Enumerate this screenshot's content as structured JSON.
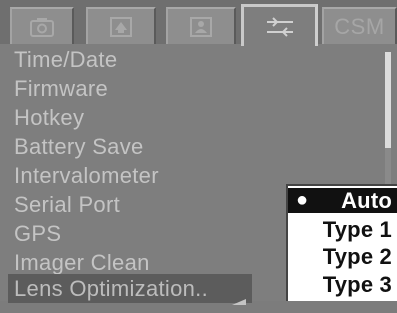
{
  "tabs": [
    {
      "name": "camera",
      "icon": "camera-icon"
    },
    {
      "name": "playback",
      "icon": "playback-icon"
    },
    {
      "name": "custom",
      "icon": "custom-settings-icon"
    },
    {
      "name": "setup",
      "icon": "wrench-icon"
    },
    {
      "name": "csm",
      "label": "CSM"
    }
  ],
  "active_tab": "setup",
  "menu": {
    "items": [
      "Time/Date",
      "Firmware",
      "Hotkey",
      "Battery Save",
      "Intervalometer",
      "Serial Port",
      "GPS",
      "Imager Clean",
      "Lens Optimization.."
    ],
    "selected_index": 8
  },
  "submenu": {
    "options": [
      "Auto",
      "Type 1",
      "Type 2",
      "Type 3"
    ],
    "selected": "Auto"
  },
  "colors": {
    "background": "#7e7e7e",
    "menu_text": "#c4c4c4",
    "selected_row": "#5c5c5c",
    "submenu_bg": "#ffffff",
    "submenu_selected": "#111111"
  }
}
